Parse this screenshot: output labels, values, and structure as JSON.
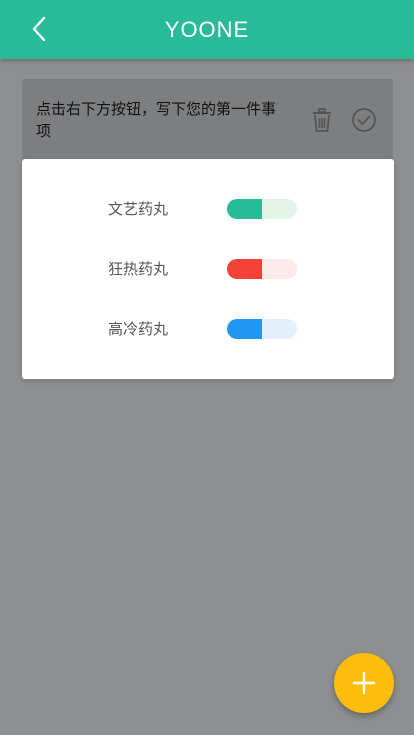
{
  "header": {
    "title": "YOONE",
    "back_icon": "chevron-left-icon"
  },
  "todo": {
    "text": "点击右下方按钮，写下您的第一件事项",
    "delete_icon": "trash-icon",
    "done_icon": "check-circle-icon"
  },
  "theme_dialog": {
    "options": [
      {
        "label": "文艺药丸",
        "color": "#27bb98",
        "light": "#e3f5e7"
      },
      {
        "label": "狂热药丸",
        "color": "#f44336",
        "light": "#fde8ea"
      },
      {
        "label": "高冷药丸",
        "color": "#2196f3",
        "light": "#e3f0fb"
      }
    ]
  },
  "fab": {
    "icon": "plus-icon",
    "color": "#fdbd0d"
  },
  "colors": {
    "primary": "#27bb98",
    "overlay_bg": "#8e8f90"
  }
}
